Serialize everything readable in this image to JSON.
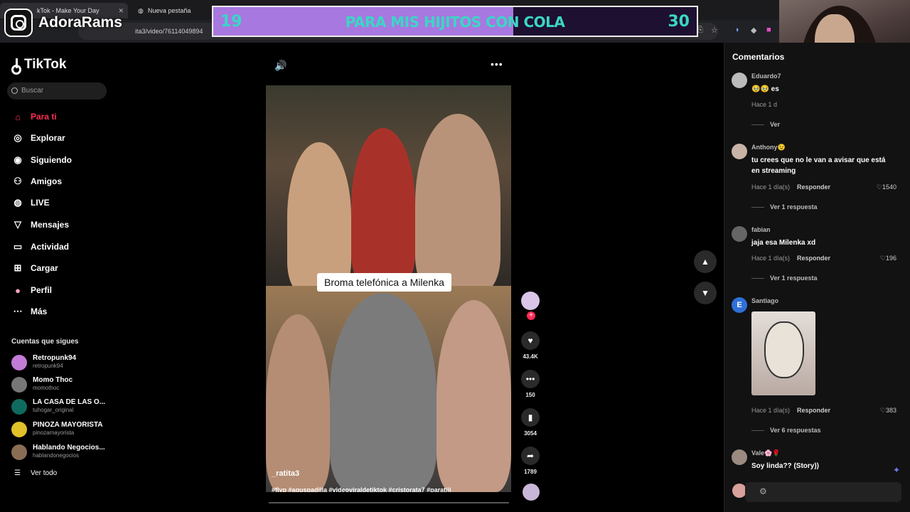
{
  "browser": {
    "tabs": [
      {
        "label": "kTok - Make Your Day",
        "active": true
      },
      {
        "label": "Nueva pestaña",
        "active": false
      }
    ],
    "address": "ita3/video/76114049894",
    "icons": [
      "back-icon",
      "reload-icon",
      "star-icon",
      "extension-icon",
      "profile-icon"
    ]
  },
  "overlay": {
    "brand_name": "AdoraRams",
    "goal": {
      "current": "19",
      "target": "30",
      "text": "PARA MIS HIJITOS CON COLA",
      "progress": 0.62,
      "fill_color": "#a778e0",
      "text_color": "#3bd7c4"
    }
  },
  "sidebar": {
    "logo": "TikTok",
    "search_placeholder": "Buscar",
    "nav": [
      {
        "label": "Para ti",
        "icon": "home-icon",
        "active": true
      },
      {
        "label": "Explorar",
        "icon": "compass-icon",
        "active": false
      },
      {
        "label": "Siguiendo",
        "icon": "following-icon",
        "active": false
      },
      {
        "label": "Amigos",
        "icon": "friends-icon",
        "active": false
      },
      {
        "label": "LIVE",
        "icon": "live-icon",
        "active": false
      },
      {
        "label": "Mensajes",
        "icon": "messages-icon",
        "active": false
      },
      {
        "label": "Actividad",
        "icon": "activity-icon",
        "active": false
      },
      {
        "label": "Cargar",
        "icon": "upload-icon",
        "active": false
      },
      {
        "label": "Perfil",
        "icon": "profile-icon",
        "active": false
      },
      {
        "label": "Más",
        "icon": "more-icon",
        "active": false
      }
    ],
    "following_title": "Cuentas que sigues",
    "accounts": [
      {
        "name": "Retropunk94",
        "handle": "retropunk94",
        "color": "#c37bd8"
      },
      {
        "name": "Momo Thoc",
        "handle": "momothoc",
        "color": "#777777"
      },
      {
        "name": "LA CASA DE LAS O...",
        "handle": "tuhogar_original",
        "color": "#0f6b5d"
      },
      {
        "name": "PINOZA MAYORISTA",
        "handle": "pinozamayorista",
        "color": "#e0c12a"
      },
      {
        "name": "Hablando Negocios...",
        "handle": "hablandonegocios",
        "color": "#8a6d55"
      }
    ],
    "see_all": "Ver todo"
  },
  "video": {
    "caption": "Broma telefónica a Milenka",
    "username": "_ratita3",
    "hashtags": "#flyp #aguspadilla #videoviraldetiktok #cristorata7 #paratiii",
    "progress": 0.0
  },
  "actions": {
    "likes": "43.4K",
    "comments": "150",
    "saves": "3054",
    "shares": "1789"
  },
  "comments": {
    "title": "Comentarios",
    "items": [
      {
        "user": "Eduardo7",
        "text": "🥹🥹 es",
        "time": "Hace 1 d",
        "more": "Ver",
        "color": "#bbbbbb"
      },
      {
        "user": "Anthony😉",
        "text": "tu crees que no le van a avisar que está en streaming",
        "time": "Hace 1 día(s)",
        "reply": "Responder",
        "likes": "1540",
        "more": "Ver 1 respuesta",
        "color": "#c9b2a6"
      },
      {
        "user": "fabian",
        "text": "jaja esa Milenka xd",
        "time": "Hace 1 día(s)",
        "reply": "Responder",
        "likes": "196",
        "more": "Ver 1 respuesta",
        "color": "#666666"
      },
      {
        "user": "Santiago",
        "avatar_letter": "E",
        "time": "Hace 1 día(s)",
        "reply": "Responder",
        "likes": "383",
        "more": "Ver 6 respuestas",
        "color": "#2f6fd8"
      },
      {
        "user": "Vale🌸🌹",
        "text": "Soy linda?? (Story))",
        "color": "#9a8a80"
      }
    ]
  }
}
